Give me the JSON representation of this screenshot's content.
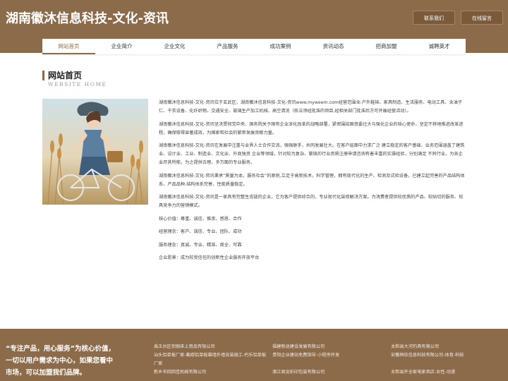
{
  "header": {
    "title": "湖南徽沐信息科技-文化-资讯",
    "contact_button": "联系我们",
    "message_button": "在线留言"
  },
  "nav": {
    "items": [
      "网站首页",
      "企业简介",
      "企业文化",
      "产品服务",
      "成功案例",
      "资讯动态",
      "招商加盟",
      "诚聘英才"
    ]
  },
  "section": {
    "title": "网站首页",
    "subtitle": "WEBSITE HOME"
  },
  "content": {
    "paragraphs": [
      "湖南徽沐信息科技-文化-资讯位于玄武区，湖南徽沐信息科技-文化-资讯www.myweem.com经营范围含:户外鞋袜、家具制造、生活服务、电动工具、含油子仁、干衣设备、化纤织物、交通安全、玻璃生产加工机械、高空清洗（依法须经批准的项目,经相关部门批准后方可开展经营活动）。",
      "湖南徽沐信息科技-文化-资讯坚决贯彻党中央、国务院关于国有企业深化改革的战略部署，紧密围绕国资委壮大与强化企业的核心使命，坚定不移地推进改革进程，确保取得显著成效，为国家和社会的繁荣发展贡献力量。",
      "湖南徽沐信息科技-文化-资讯在发展中注重与业界人士合作交流，强强联手，共同发展壮大。在客户层面中力求广泛 建立稳定的客户基础，业务范围涵盖了建筑业、设计业、工业、制造业、文化业、外商独资 企业等领域，针对较为复杂、繁琐的行业资质注册申请咨询有着丰富的实操经验，分别满足 不同行业，为各企业尽其所能，为之提供合理、多方面的专业服务。",
      "湖南徽沐信息科技-文化-资讯秉承“质量为本，服务社会”的原则,立足于高新技术，科学管理，拥有现代化的生产、检测及试验设备，已建立起完善的产品结构体系，产品品种,结构体系完善，性能质量稳定。",
      "湖南徽沐信息科技-文化-资讯是一家具有完整生态链的企业，它为客户提供综合的、专业现代化装修解决方案。为消费者提供较优质的产品、较贴切的服务、较具竞争力的营销模式。",
      "核心价值：尊重、诚信、推崇、感恩、合作",
      "经营理念：客户、诚信、专业、团队、成功",
      "服务理念：真诚、专业、精准、周全、可靠",
      "企业愿景：成为较受信任的创新性企业服务开放平台"
    ]
  },
  "footer": {
    "slogan": "“专注产品，用心服务”为核心价值，一切以用户需求为中心，如果您看中市场，可以加盟我们品牌。",
    "links_col1": [
      "禹王台区到钢床上用品有限公司",
      "汕头铝单板厂家-氟碳铝单板幕墙外墙安装施工-朽乐铝单板厂家",
      "新乡市四四佳机械有限公司"
    ],
    "links_col2": [
      "福建新途建设发展有限公司",
      "贵阳企业建站免费指导-小程序开发",
      "滴江君龙彩印包装有限公司"
    ],
    "links_col3": [
      "太和县大河钓具有限公司",
      "安徽桓玖信息科技有限公司-体育-科技",
      "太和县开全家电家具店-女性-动漫"
    ]
  },
  "colors": {
    "brand": "#8c6b4a"
  }
}
